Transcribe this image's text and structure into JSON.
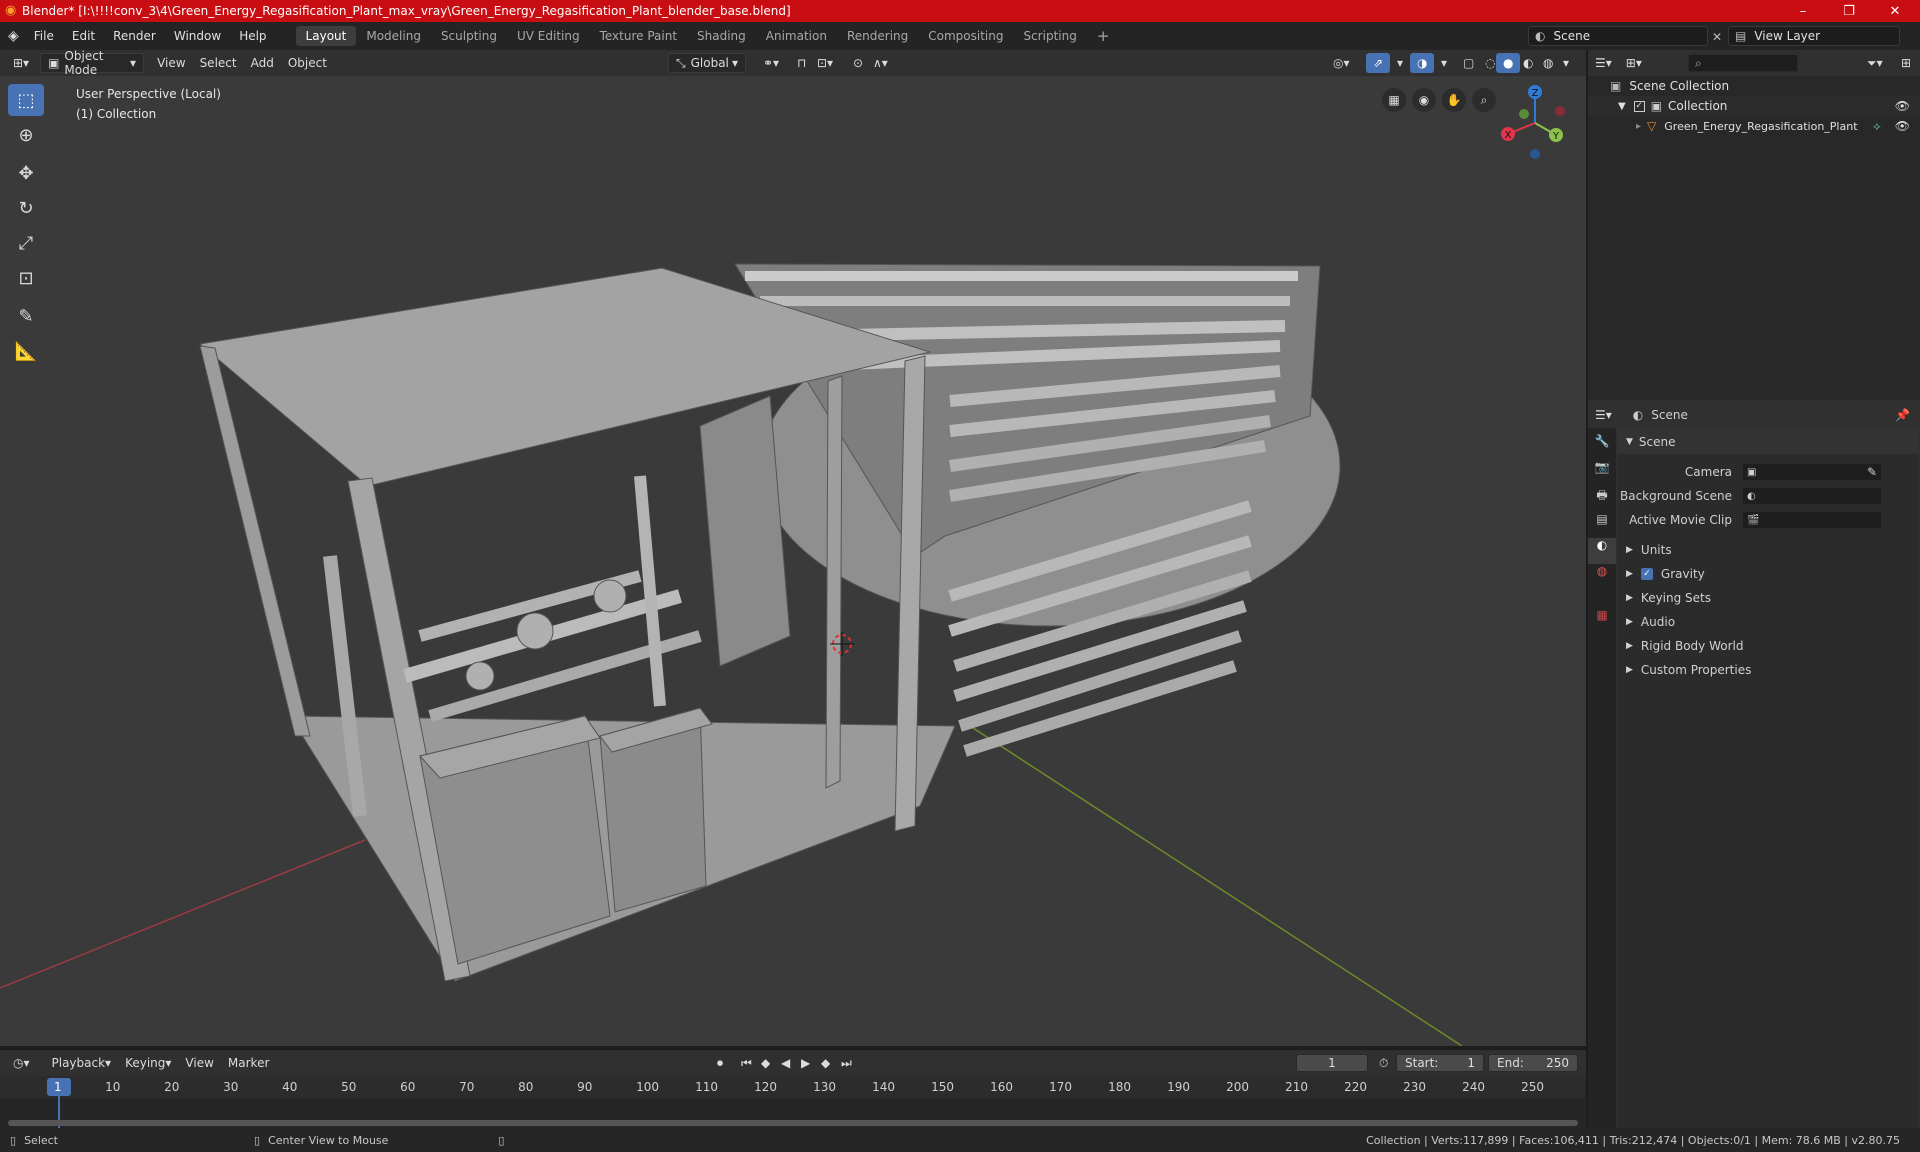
{
  "titlebar": {
    "title": "Blender* [I:\\!!!!conv_3\\4\\Green_Energy_Regasification_Plant_max_vray\\Green_Energy_Regasification_Plant_blender_base.blend]",
    "minimize": "–",
    "maximize": "❐",
    "close": "✕"
  },
  "menubar": {
    "menus": [
      "File",
      "Edit",
      "Render",
      "Window",
      "Help"
    ],
    "workspaces": [
      "Layout",
      "Modeling",
      "Sculpting",
      "UV Editing",
      "Texture Paint",
      "Shading",
      "Animation",
      "Rendering",
      "Compositing",
      "Scripting"
    ],
    "add_tab": "+",
    "scene": "Scene",
    "view_layer": "View Layer"
  },
  "viewport_header": {
    "mode": "Object Mode",
    "view": "View",
    "select": "Select",
    "add": "Add",
    "object": "Object",
    "transform": "Global"
  },
  "viewport": {
    "line1": "User Perspective (Local)",
    "line2": "(1) Collection"
  },
  "gizmo": {
    "z": "Z",
    "y": "Y",
    "x": "X"
  },
  "outliner": {
    "search_placeholder": "",
    "scene_collection": "Scene Collection",
    "collection": "Collection",
    "object": "Green_Energy_Regasification_Plant"
  },
  "properties": {
    "scene_label": "Scene",
    "panel_title": "Scene",
    "fields": [
      {
        "label": "Camera",
        "value": ""
      },
      {
        "label": "Background Scene",
        "value": ""
      },
      {
        "label": "Active Movie Clip",
        "value": ""
      }
    ],
    "sections": [
      "Units",
      "Gravity",
      "Keying Sets",
      "Audio",
      "Rigid Body World",
      "Custom Properties"
    ],
    "gravity_checked": true
  },
  "timeline": {
    "playback": "Playback",
    "keying": "Keying",
    "view": "View",
    "marker": "Marker",
    "current_frame": "1",
    "start_label": "Start:",
    "start": "1",
    "end_label": "End:",
    "end": "250",
    "ticks": [
      "1",
      "10",
      "20",
      "30",
      "40",
      "50",
      "60",
      "70",
      "80",
      "90",
      "100",
      "110",
      "120",
      "130",
      "140",
      "150",
      "160",
      "170",
      "180",
      "190",
      "200",
      "210",
      "220",
      "230",
      "240",
      "250"
    ]
  },
  "statusbar": {
    "select": "Select",
    "center": "Center View to Mouse",
    "stats": "Collection | Verts:117,899 | Faces:106,411 | Tris:212,474 | Objects:0/1 | Mem: 78.6 MB | v2.80.75"
  },
  "colors": {
    "accent": "#4772b3",
    "title_red": "#c80e12",
    "x_axis": "#e0344a",
    "y_axis": "#8bc34a",
    "z_axis": "#2f7bd7"
  }
}
